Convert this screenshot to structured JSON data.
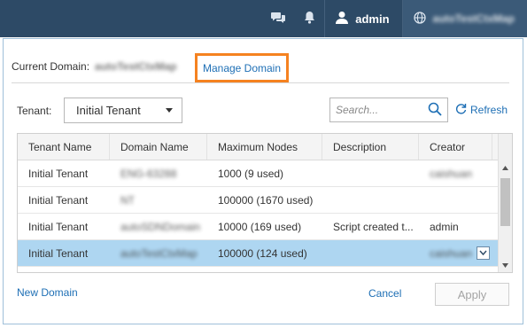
{
  "topbar": {
    "chat_icon": "chat-bubbles-icon",
    "bell_icon": "bell-icon",
    "user_icon": "user-icon",
    "username": "admin",
    "globe_icon": "globe-icon",
    "domain": "autoTestCtxMap"
  },
  "dialog": {
    "current_domain_label": "Current Domain:",
    "current_domain_value": "autoTestCtxMap",
    "manage_domain_link": "Manage Domain",
    "tenant_label": "Tenant:",
    "tenant_selected": "Initial Tenant",
    "search_placeholder": "Search...",
    "refresh_label": "Refresh",
    "table": {
      "columns": [
        "Tenant Name",
        "Domain Name",
        "Maximum Nodes",
        "Description",
        "Creator"
      ],
      "rows": [
        {
          "tenant": "Initial Tenant",
          "domain": "ENG-63288",
          "max_nodes": "1000 (9 used)",
          "description": "",
          "creator": "caishuan"
        },
        {
          "tenant": "Initial Tenant",
          "domain": "NT",
          "max_nodes": "100000 (1670 used)",
          "description": "",
          "creator": ""
        },
        {
          "tenant": "Initial Tenant",
          "domain": "autoSDNDomain",
          "max_nodes": "10000 (169 used)",
          "description": "Script created t...",
          "creator": "admin"
        },
        {
          "tenant": "Initial Tenant",
          "domain": "autoTestCtxMap",
          "max_nodes": "100000 (124 used)",
          "description": "",
          "creator": "caishuan"
        }
      ]
    },
    "new_domain_link": "New Domain",
    "cancel_label": "Cancel",
    "apply_label": "Apply"
  },
  "colors": {
    "topbar_bg": "#2d4a66",
    "highlight_border": "#f58220",
    "link": "#1e6fb5",
    "selected_row": "#aed6f1"
  }
}
